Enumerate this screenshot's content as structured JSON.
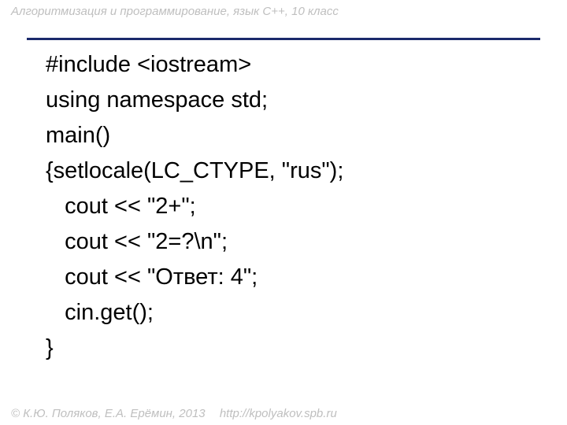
{
  "header": {
    "title": "Алгоритмизация и программирование, язык  C++, 10 класс"
  },
  "code": {
    "lines": [
      "#include <iostream>",
      "using namespace std;",
      "main()",
      "{setlocale(LC_CTYPE, \"rus\");",
      "   cout << \"2+\";",
      "   cout << \"2=?\\n\";",
      "   cout << \"Ответ: 4\";",
      "   cin.get();",
      "}"
    ]
  },
  "footer": {
    "copyright": "© К.Ю. Поляков, Е.А. Ерёмин, 2013",
    "url": "http://kpolyakov.spb.ru"
  }
}
